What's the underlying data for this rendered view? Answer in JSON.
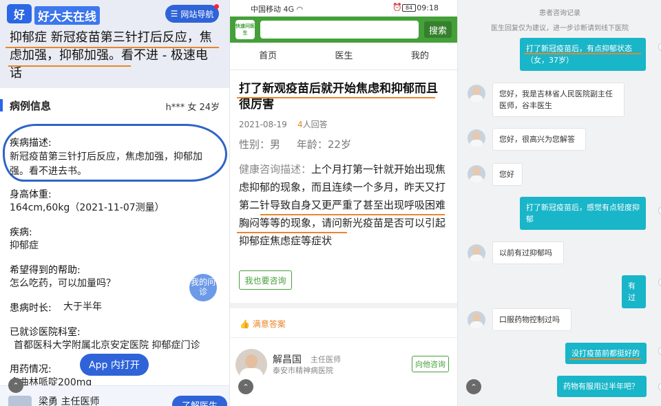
{
  "left": {
    "logo_icon": "好",
    "logo": "好大夫在线",
    "nav_label": "网站导航",
    "title": "抑郁症 新冠疫苗第三针打后反应，焦虑加强，抑郁加强。看不进 - 极速电话",
    "case_info_label": "病例信息",
    "patient": "h*** 女 24岁",
    "desc_label": "疾病描述:",
    "desc_value": "新冠疫苗第三针打后反应，焦虑加强，抑郁加强。看不进去书。",
    "height_label": "身高体重:",
    "height_value": "164cm,60kg（2021-11-07测量）",
    "disease_label": "疾病:",
    "disease_value": "抑郁症",
    "help_label": "希望得到的帮助:",
    "help_value": "怎么吃药，可以加量吗？",
    "duration_label": "患病时长:",
    "duration_value": "大于半年",
    "hospital_label": "已就诊医院科室:",
    "hospital_value": "首都医科大学附属北京安定医院 抑郁症门诊",
    "med_label": "用药情况:",
    "med_value": "舍曲林哌啶200mg",
    "my_consult": "我的问诊",
    "app_open": "App 内打开",
    "doctor_name": "梁勇  主任医师",
    "learn_doctor": "了解医生",
    "accent": "#2b67e6",
    "underline_color": "#e8862a"
  },
  "middle": {
    "carrier": "中国移动",
    "signal": "4G  ",
    "time": "09:18",
    "battery": "84",
    "app_logo": "快速问医生",
    "search_btn": "搜索",
    "tabs": [
      "首页",
      "医生",
      "我的"
    ],
    "title": "打了新观疫苗后就开始焦虑和抑郁而且很厉害",
    "date": "2021-08-19",
    "answers_num": "4",
    "answers_suffix": "人回答",
    "gender": "性别：男",
    "age": "年龄：22岁",
    "desc_label": "健康咨询描述：",
    "desc": "上个月打第一针就开始出现焦虑抑郁的现象，而且连续一个多月，昨天又打第二针导致自身又更严重了甚至出现呼吸困难胸闷等等的现象，请问新光疫苗是否可以引起抑郁症焦虑症等症状",
    "ask_btn": "我也要咨询",
    "answers_header": "满意答案",
    "doctor_name": "解昌国",
    "doctor_title": "主任医师",
    "doctor_hospital": "泰安市精神病医院",
    "consult_btn": "向他咨询",
    "brand": "#45a03a"
  },
  "right": {
    "header": "患者咨询记录",
    "subheader": "医生回复仅为建议，进一步诊断请到线下医院",
    "messages": [
      {
        "side": "r",
        "text": "打了新冠疫苗后，有点抑郁状态（女，37岁）"
      },
      {
        "side": "l",
        "text": "您好，我是吉林省人民医院副主任医师，谷丰医生"
      },
      {
        "side": "l",
        "text": "您好，很高兴为您解答"
      },
      {
        "side": "l",
        "text": "您好"
      },
      {
        "side": "r",
        "text": "打了新冠疫苗后，感觉有点轻度抑郁"
      },
      {
        "side": "l",
        "text": "以前有过抑郁吗"
      },
      {
        "side": "r",
        "text": "有过"
      },
      {
        "side": "l",
        "text": "口服药物控制过吗"
      },
      {
        "side": "r",
        "text": "没打疫苗前都挺好的"
      },
      {
        "side": "r",
        "text": "药物有服用过半年吧？"
      }
    ],
    "bubble_color": "#19b5c8"
  }
}
